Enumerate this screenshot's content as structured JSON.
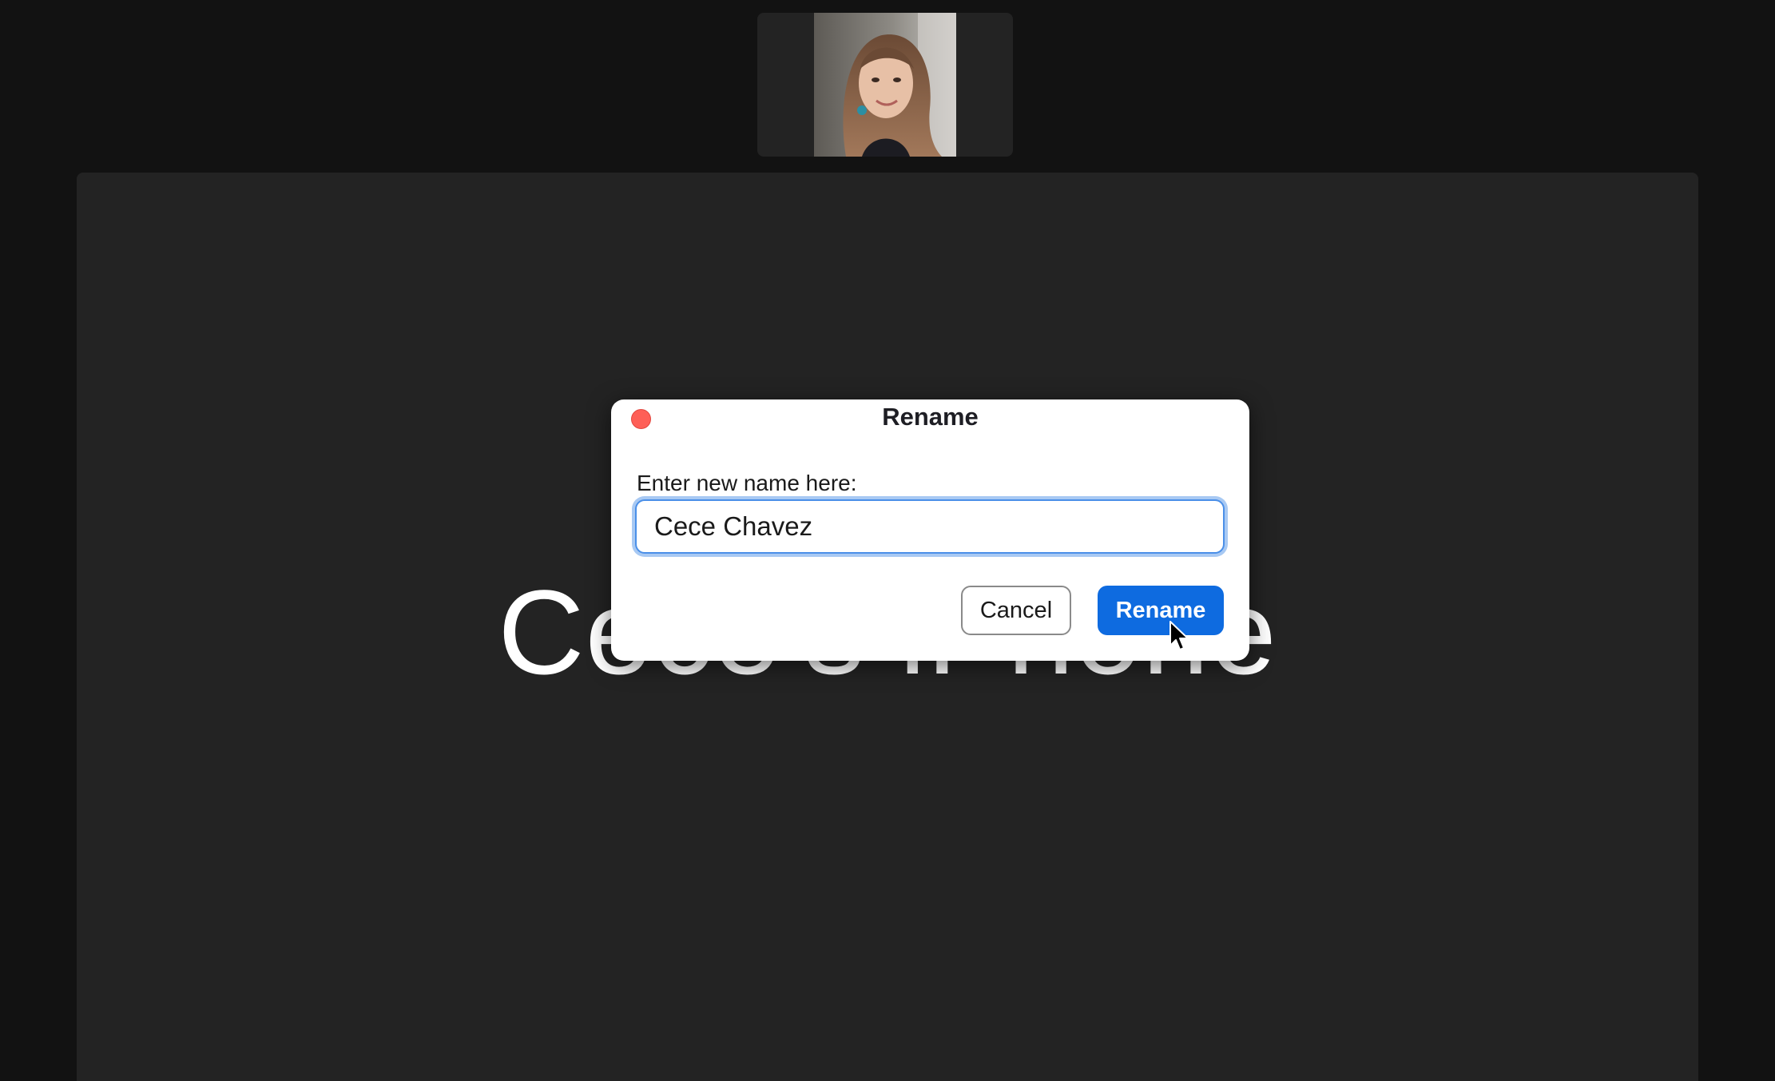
{
  "thumbnail": {
    "icon": "participant-video-thumbnail"
  },
  "main": {
    "participant_name": "Cece's iPhone"
  },
  "dialog": {
    "title": "Rename",
    "field_label": "Enter new name here:",
    "input_value": "Cece Chavez",
    "cancel_label": "Cancel",
    "rename_label": "Rename",
    "close_icon": "close-traffic-light-icon"
  },
  "colors": {
    "accent": "#0e6be0",
    "close": "#fe5f57",
    "background": "#121212",
    "panel": "#232323"
  }
}
